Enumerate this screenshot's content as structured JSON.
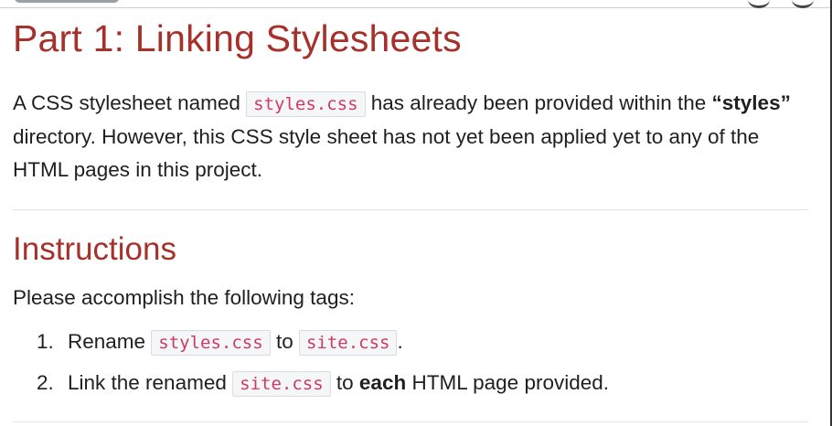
{
  "part1": {
    "title": "Part 1: Linking Stylesheets",
    "intro": {
      "t1": "A CSS stylesheet named ",
      "code1": "styles.css",
      "t2": " has already been provided within the ",
      "bold": "“styles”",
      "t3": " directory. However, this CSS style sheet has not yet been applied yet to any of the HTML pages in this project."
    }
  },
  "instructions": {
    "heading": "Instructions",
    "lead": "Please accomplish the following tags:",
    "steps": [
      {
        "num": "1.",
        "t1": "Rename ",
        "code1": "styles.css",
        "t2": " to ",
        "code2": "site.css",
        "t3": "."
      },
      {
        "num": "2.",
        "t1": "Link the renamed ",
        "code1": "site.css",
        "t2": " to ",
        "bold": "each",
        "t3": " HTML page provided."
      }
    ]
  }
}
